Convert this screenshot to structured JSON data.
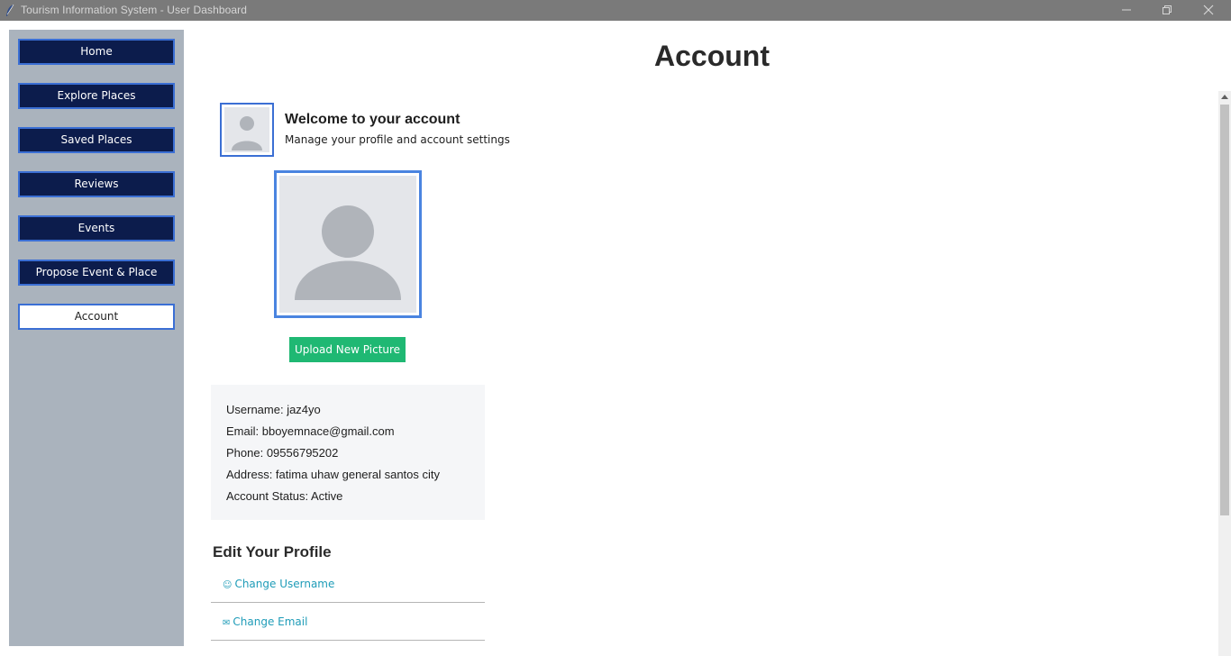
{
  "window": {
    "title": "Tourism Information System - User Dashboard"
  },
  "sidebar": {
    "items": [
      {
        "label": "Home"
      },
      {
        "label": "Explore Places"
      },
      {
        "label": "Saved Places"
      },
      {
        "label": "Reviews"
      },
      {
        "label": "Events"
      },
      {
        "label": "Propose Event & Place"
      },
      {
        "label": "Account",
        "active": true
      }
    ]
  },
  "main": {
    "title": "Account",
    "welcome": {
      "title": "Welcome to your account",
      "subtitle": "Manage your profile and account settings"
    },
    "upload_button": "Upload New Picture",
    "info": {
      "username": "Username: jaz4yo",
      "email": "Email: bboyemnace@gmail.com",
      "phone": "Phone: 09556795202",
      "address": "Address: fatima uhaw general santos city",
      "status": "Account Status: Active"
    },
    "edit": {
      "title": "Edit Your Profile",
      "links": [
        {
          "label": "Change Username",
          "icon": "user-icon"
        },
        {
          "label": "Change Email",
          "icon": "email-icon"
        }
      ]
    }
  },
  "colors": {
    "sidebar_bg": "#aab3bd",
    "nav_button_bg": "#0c1c4c",
    "nav_button_border": "#3b6fd4",
    "upload_button_bg": "#1fb873",
    "link_color": "#1f9cb8"
  }
}
